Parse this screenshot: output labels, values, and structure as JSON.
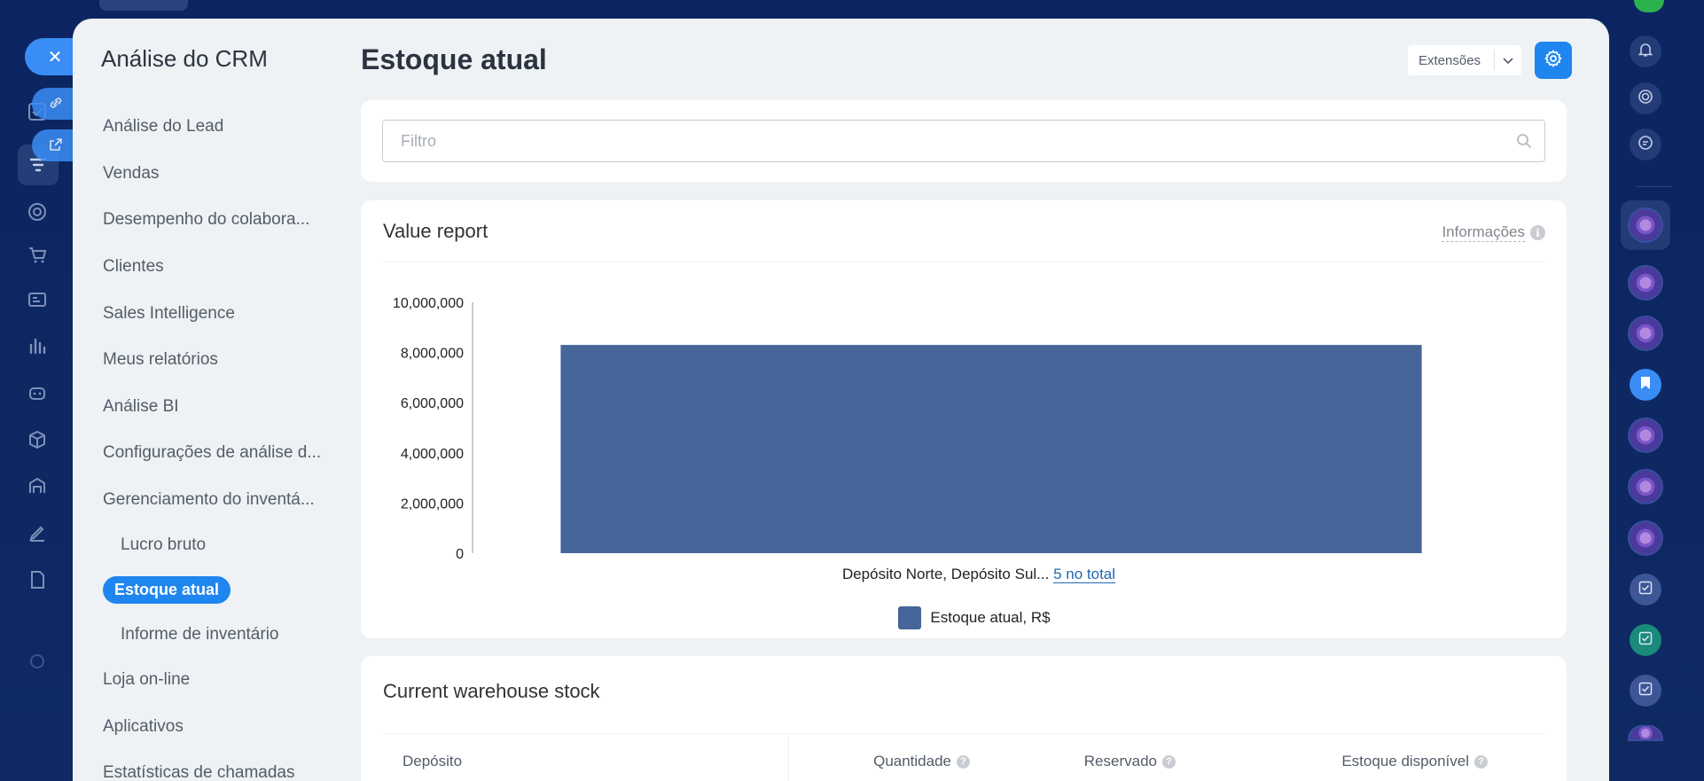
{
  "sidebar": {
    "title": "Análise do CRM",
    "items": [
      {
        "label": "Análise do Lead"
      },
      {
        "label": "Vendas"
      },
      {
        "label": "Desempenho do colabora..."
      },
      {
        "label": "Clientes"
      },
      {
        "label": "Sales Intelligence"
      },
      {
        "label": "Meus relatórios"
      },
      {
        "label": "Análise BI"
      },
      {
        "label": "Configurações de análise d..."
      },
      {
        "label": "Gerenciamento do inventá..."
      },
      {
        "label": "Lucro bruto"
      },
      {
        "label": "Estoque atual"
      },
      {
        "label": "Informe de inventário"
      },
      {
        "label": "Loja on-line"
      },
      {
        "label": "Aplicativos"
      },
      {
        "label": "Estatísticas de chamadas"
      }
    ]
  },
  "header": {
    "title": "Estoque atual",
    "extensions_label": "Extensões"
  },
  "filter": {
    "placeholder": "Filtro"
  },
  "value_report": {
    "title": "Value report",
    "info_label": "Informações",
    "x_label_text": "Depósito Norte, Depósito Sul...",
    "x_label_link": "5 no total",
    "legend_label": "Estoque atual, R$"
  },
  "chart_data": {
    "type": "bar",
    "categories": [
      "Depósito Norte, Depósito Sul..."
    ],
    "series": [
      {
        "name": "Estoque atual, R$",
        "values": [
          8300000
        ]
      }
    ],
    "ylim": [
      0,
      10000000
    ],
    "yticks": [
      0,
      2000000,
      4000000,
      6000000,
      8000000,
      10000000
    ],
    "ytick_labels": [
      "0",
      "2,000,000",
      "4,000,000",
      "6,000,000",
      "8,000,000",
      "10,000,000"
    ],
    "grid": false,
    "legend_position": "bottom",
    "color": "#466599"
  },
  "warehouse_stock": {
    "title": "Current warehouse stock",
    "columns": [
      "Depósito",
      "Quantidade",
      "Reservado",
      "Estoque disponível"
    ]
  },
  "colors": {
    "accent": "#1f85ef",
    "bar": "#466599",
    "panel_bg": "#eef2f4",
    "app_bg": "#0f2a63"
  }
}
